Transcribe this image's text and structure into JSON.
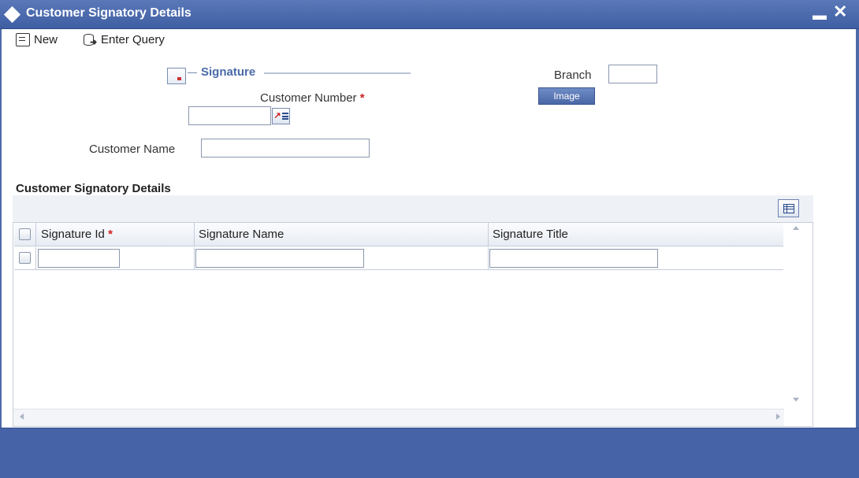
{
  "window": {
    "title": "Customer Signatory Details"
  },
  "toolbar": {
    "new_label": "New",
    "enter_query_label": "Enter Query"
  },
  "form": {
    "signature_legend": "Signature",
    "customer_number_label": "Customer Number",
    "required_marker": "*",
    "customer_number_value": "",
    "customer_name_label": "Customer Name",
    "customer_name_value": "",
    "branch_label": "Branch",
    "branch_value": "",
    "image_button_label": "Image"
  },
  "grid": {
    "section_title": "Customer Signatory Details",
    "columns": [
      {
        "label": "Signature Id",
        "required": true
      },
      {
        "label": "Signature Name",
        "required": false
      },
      {
        "label": "Signature Title",
        "required": false
      }
    ],
    "rows": [
      {
        "signature_id": "",
        "signature_name": "",
        "signature_title": ""
      }
    ]
  },
  "colors": {
    "title_bar": "#4563a6",
    "legend": "#4a6aa8",
    "required": "#d02020"
  }
}
